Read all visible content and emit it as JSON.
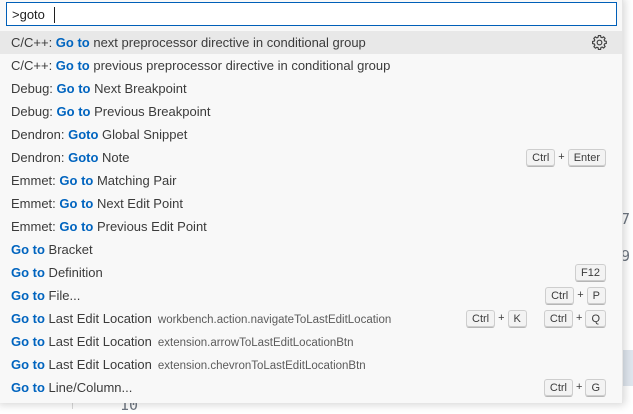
{
  "search": {
    "value": ">goto"
  },
  "items": [
    {
      "prefix": "C/C++: ",
      "hl": "Go to",
      "rest": " next preprocessor directive in conditional group",
      "desc": "",
      "keys": [],
      "active": true,
      "gear": "gear-icon"
    },
    {
      "prefix": "C/C++: ",
      "hl": "Go to",
      "rest": " previous preprocessor directive in conditional group",
      "desc": "",
      "keys": []
    },
    {
      "prefix": "Debug: ",
      "hl": "Go to",
      "rest": " Next Breakpoint",
      "desc": "",
      "keys": []
    },
    {
      "prefix": "Debug: ",
      "hl": "Go to",
      "rest": " Previous Breakpoint",
      "desc": "",
      "keys": []
    },
    {
      "prefix": "Dendron: ",
      "hl": "Goto",
      "rest": " Global Snippet",
      "desc": "",
      "keys": []
    },
    {
      "prefix": "Dendron: ",
      "hl": "Goto",
      "rest": " Note",
      "desc": "",
      "keys": [
        [
          "Ctrl",
          "Enter"
        ]
      ]
    },
    {
      "prefix": "Emmet: ",
      "hl": "Go to",
      "rest": " Matching Pair",
      "desc": "",
      "keys": []
    },
    {
      "prefix": "Emmet: ",
      "hl": "Go to",
      "rest": " Next Edit Point",
      "desc": "",
      "keys": []
    },
    {
      "prefix": "Emmet: ",
      "hl": "Go to",
      "rest": " Previous Edit Point",
      "desc": "",
      "keys": []
    },
    {
      "prefix": "",
      "hl": "Go to",
      "rest": " Bracket",
      "desc": "",
      "keys": []
    },
    {
      "prefix": "",
      "hl": "Go to",
      "rest": " Definition",
      "desc": "",
      "keys": [
        [
          "F12"
        ]
      ]
    },
    {
      "prefix": "",
      "hl": "Go to",
      "rest": " File...",
      "desc": "",
      "keys": [
        [
          "Ctrl",
          "P"
        ]
      ]
    },
    {
      "prefix": "",
      "hl": "Go to",
      "rest": " Last Edit Location",
      "desc": "workbench.action.navigateToLastEditLocation",
      "keys": [
        [
          "Ctrl",
          "K"
        ],
        [
          "Ctrl",
          "Q"
        ]
      ]
    },
    {
      "prefix": "",
      "hl": "Go to",
      "rest": " Last Edit Location",
      "desc": "extension.arrowToLastEditLocationBtn",
      "keys": []
    },
    {
      "prefix": "",
      "hl": "Go to",
      "rest": " Last Edit Location",
      "desc": "extension.chevronToLastEditLocationBtn",
      "keys": []
    },
    {
      "prefix": "",
      "hl": "Go to",
      "rest": " Line/Column...",
      "desc": "",
      "keys": [
        [
          "Ctrl",
          "G"
        ]
      ]
    }
  ],
  "background": {
    "line_num_bottom": "10",
    "right_num_1": "7",
    "right_num_2": "9"
  },
  "colors": {
    "highlight": "#0064bf",
    "focus_border": "#005fb8",
    "active_row": "#e8e8e8"
  }
}
